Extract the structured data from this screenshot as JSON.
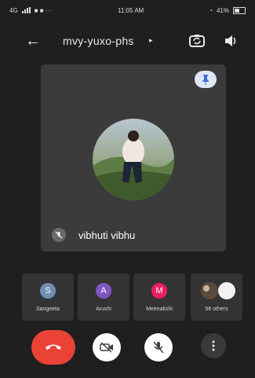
{
  "status_bar": {
    "left_info": "4G",
    "time": "11:05 AM",
    "battery": "41%"
  },
  "header": {
    "title": "mvy-yuxo-phs",
    "caret": "▸",
    "back_icon": "arrow-left-icon",
    "switch_camera_icon": "switch-camera-icon",
    "speaker_icon": "speaker-icon"
  },
  "main_tile": {
    "participant_name": "vibhuti vibhu",
    "pin_icon": "pin-icon",
    "mic_state": "muted"
  },
  "participants": [
    {
      "name": "Sangeeta",
      "initial": "S",
      "color": "#6f8eb0"
    },
    {
      "name": "Arushi",
      "initial": "A",
      "color": "#7e57c2"
    },
    {
      "name": "Meenakshi",
      "initial": "M",
      "color": "#e91e63"
    },
    {
      "name": "56 others",
      "initial": "",
      "color": "#cfcfcf"
    }
  ],
  "controls": {
    "end_call_icon": "end-call-icon",
    "camera_icon": "camera-off-icon",
    "mic_icon": "mic-off-icon",
    "more_icon": "more-vertical-icon",
    "end_call_color": "#ea4335"
  }
}
